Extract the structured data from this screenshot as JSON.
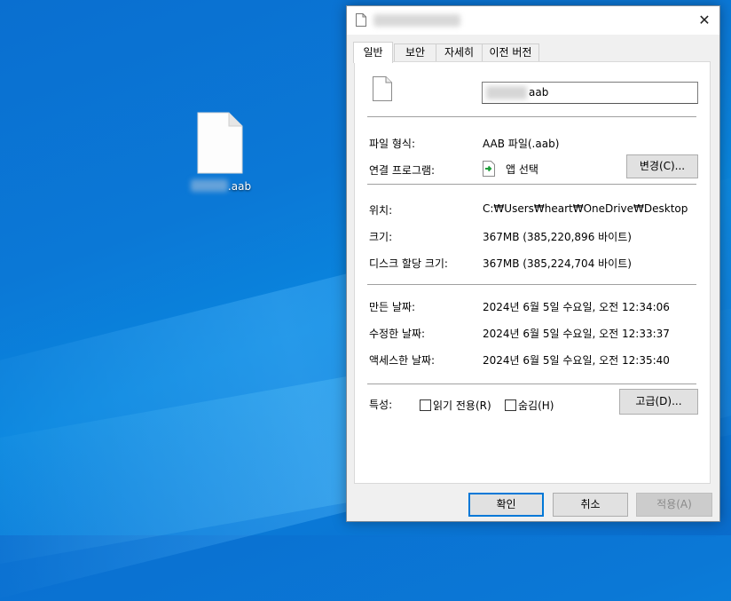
{
  "desktop": {
    "file_label_suffix": ".aab"
  },
  "dialog": {
    "close_glyph": "✕",
    "tabs": [
      {
        "label": "일반",
        "active": true
      },
      {
        "label": "보안"
      },
      {
        "label": "자세히"
      },
      {
        "label": "이전 버전"
      }
    ],
    "name_suffix": "aab",
    "file_type_label": "파일 형식:",
    "file_type_value": "AAB 파일(.aab)",
    "opens_with_label": "연결 프로그램:",
    "opens_with_value": "앱 선택",
    "change_button": "변경(C)...",
    "location_label": "위치:",
    "location_value": "C:₩Users₩heart₩OneDrive₩Desktop",
    "size_label": "크기:",
    "size_value": "367MB (385,220,896 바이트)",
    "size_on_disk_label": "디스크 할당 크기:",
    "size_on_disk_value": "367MB (385,224,704 바이트)",
    "created_label": "만든 날짜:",
    "created_value": "2024년 6월 5일 수요일, 오전 12:34:06",
    "modified_label": "수정한 날짜:",
    "modified_value": "2024년 6월 5일 수요일, 오전 12:33:37",
    "accessed_label": "액세스한 날짜:",
    "accessed_value": "2024년 6월 5일 수요일, 오전 12:35:40",
    "attributes_label": "특성:",
    "readonly_label": "읽기 전용(R)",
    "hidden_label": "숨김(H)",
    "advanced_button": "고급(D)...",
    "ok_button": "확인",
    "cancel_button": "취소",
    "apply_button": "적용(A)"
  },
  "colors": {
    "desktop_bg": "#0a78d6",
    "primary_border": "#0078d7",
    "dialog_bg": "#f0f0f0"
  },
  "icons": {
    "file": "blank-file-icon",
    "app": "app-select-icon",
    "close": "close-icon"
  }
}
